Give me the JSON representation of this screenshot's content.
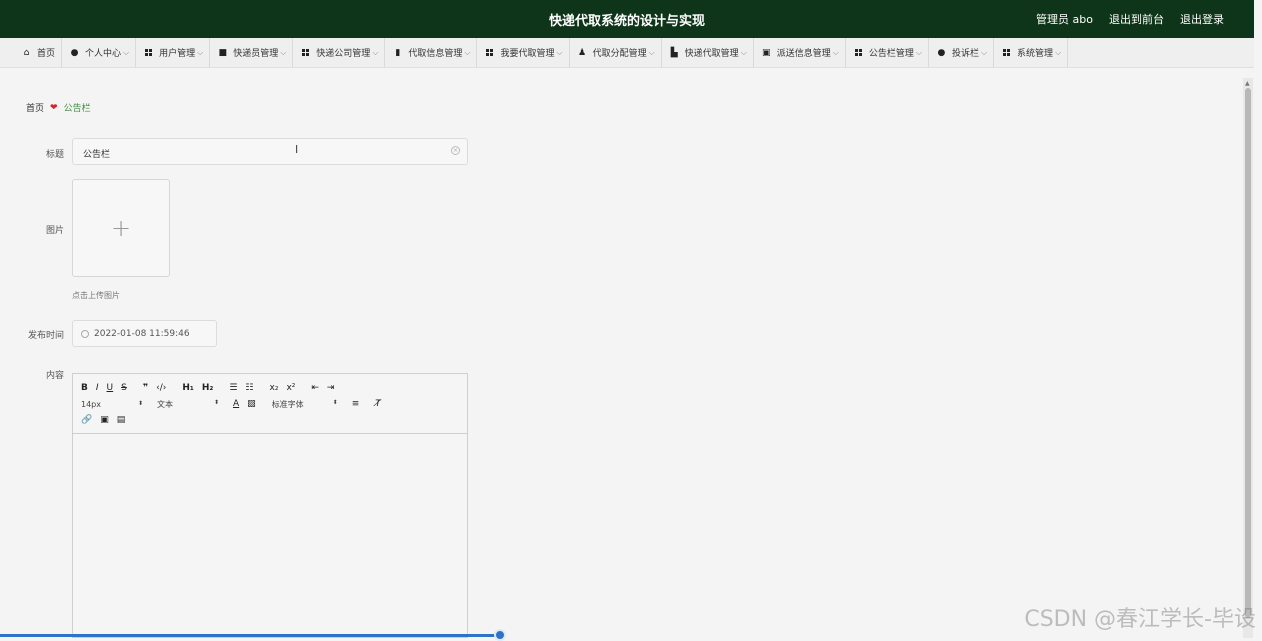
{
  "header": {
    "title": "快递代取系统的设计与实现",
    "user": "管理员 abo",
    "to_front": "退出到前台",
    "logout": "退出登录"
  },
  "nav": [
    {
      "label": "首页",
      "icon": "home-icon",
      "has_menu": false
    },
    {
      "label": "个人中心",
      "icon": "user-icon",
      "has_menu": true
    },
    {
      "label": "用户管理",
      "icon": "grid-icon",
      "has_menu": true
    },
    {
      "label": "快递员管理",
      "icon": "briefcase-icon",
      "has_menu": true
    },
    {
      "label": "快递公司管理",
      "icon": "grid-icon",
      "has_menu": true
    },
    {
      "label": "代取信息管理",
      "icon": "clipboard-icon",
      "has_menu": true
    },
    {
      "label": "我要代取管理",
      "icon": "grid-icon",
      "has_menu": true
    },
    {
      "label": "代取分配管理",
      "icon": "person-icon",
      "has_menu": true
    },
    {
      "label": "快递代取管理",
      "icon": "bar-chart-icon",
      "has_menu": true
    },
    {
      "label": "派送信息管理",
      "icon": "trash-icon",
      "has_menu": true
    },
    {
      "label": "公告栏管理",
      "icon": "grid-icon",
      "has_menu": true
    },
    {
      "label": "投诉栏",
      "icon": "pin-icon",
      "has_menu": true
    },
    {
      "label": "系统管理",
      "icon": "grid-icon",
      "has_menu": true
    }
  ],
  "breadcrumb": {
    "home": "首页",
    "current": "公告栏"
  },
  "form": {
    "title_label": "标题",
    "title_value": "公告栏",
    "image_label": "图片",
    "upload_tip": "点击上传图片",
    "time_label": "发布时间",
    "time_value": "2022-01-08 11:59:46",
    "content_label": "内容"
  },
  "editor": {
    "font_size": "14px",
    "paragraph": "文本",
    "font_family": "标准字体"
  },
  "watermark": "CSDN @春江学长-毕设"
}
